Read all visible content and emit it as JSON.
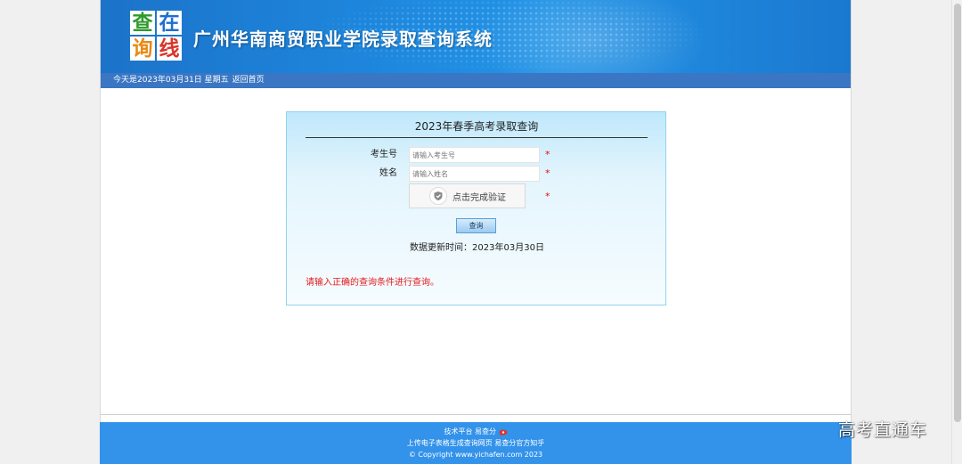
{
  "header": {
    "logo_chars": [
      "查",
      "在",
      "询",
      "线"
    ],
    "title": "广州华南商贸职业学院录取查询系统"
  },
  "datebar": {
    "date_text": "今天是2023年03月31日 星期五",
    "home_link": "返回首页"
  },
  "form": {
    "title": "2023年春季高考录取查询",
    "fields": [
      {
        "label": "考生号",
        "placeholder": "请输入考生号",
        "value": "",
        "required_mark": "*"
      },
      {
        "label": "姓名",
        "placeholder": "请输入姓名",
        "value": "",
        "required_mark": "*"
      }
    ],
    "captcha": {
      "label": "点击完成验证",
      "required_mark": "*"
    },
    "submit_label": "查询",
    "update_text": "数据更新时间：2023年03月30日",
    "hint": "请输入正确的查询条件进行查询。"
  },
  "footer": {
    "line1": "技术平台 易查分",
    "line2_upload": "上传电子表格生成查询网页",
    "line2_zhihu": "易查分官方知乎",
    "copyright": "© Copyright www.yichafen.com 2023"
  },
  "watermark": "高考直通车",
  "colors": {
    "banner": "#1d86dc",
    "datebar": "#3a76c3",
    "footer": "#3392ea",
    "required": "#e01010",
    "hint": "#e31c1c",
    "panel_border": "#8fd3f0"
  },
  "icons": {
    "captcha": "shield-check-icon",
    "footer_bubble": "chat-bubble-icon"
  }
}
